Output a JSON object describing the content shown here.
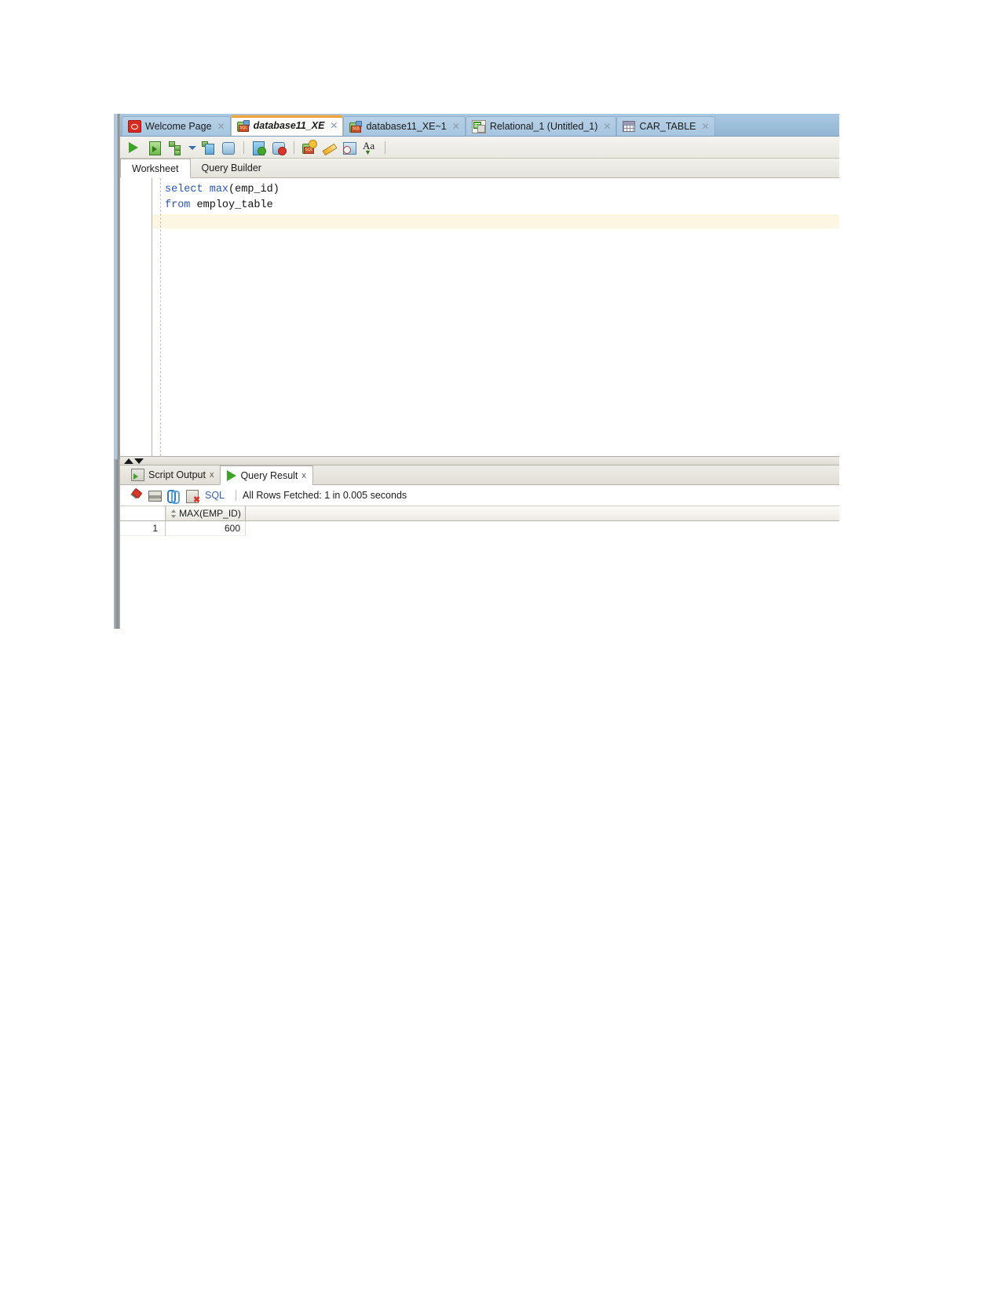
{
  "window": {
    "tabs": [
      {
        "label": "Welcome Page",
        "icon": "oracle-logo-icon",
        "active": false,
        "closable": true
      },
      {
        "label": "database11_XE",
        "icon": "database-connection-icon",
        "active": true,
        "closable": true
      },
      {
        "label": "database11_XE~1",
        "icon": "database-connection-icon",
        "active": false,
        "closable": true
      },
      {
        "label": "Relational_1 (Untitled_1)",
        "icon": "relational-model-icon",
        "active": false,
        "closable": true
      },
      {
        "label": "CAR_TABLE",
        "icon": "table-grid-icon",
        "active": false,
        "closable": true
      }
    ]
  },
  "toolbar": {
    "buttons": [
      {
        "name": "run-statement-button",
        "icon": "green-play-icon",
        "tooltip": "Run Statement"
      },
      {
        "name": "run-script-button",
        "icon": "run-script-icon",
        "tooltip": "Run Script"
      },
      {
        "name": "explain-plan-button",
        "icon": "explain-plan-icon",
        "tooltip": "Explain Plan"
      },
      {
        "name": "explain-plan-dropdown",
        "icon": "chevron-down-icon",
        "tooltip": "More"
      },
      {
        "name": "autotrace-button",
        "icon": "autotrace-icon",
        "tooltip": "Autotrace"
      },
      {
        "name": "sql-tuning-advisor-button",
        "icon": "sql-tuning-icon",
        "tooltip": "SQL Tuning Advisor"
      },
      {
        "name": "commit-button",
        "icon": "commit-icon",
        "tooltip": "Commit"
      },
      {
        "name": "rollback-button",
        "icon": "rollback-icon",
        "tooltip": "Rollback"
      },
      {
        "name": "unshared-sql-worksheet-button",
        "icon": "new-worksheet-icon",
        "tooltip": "Unshared SQL Worksheet"
      },
      {
        "name": "clear-button",
        "icon": "eraser-icon",
        "tooltip": "Clear"
      },
      {
        "name": "sql-history-button",
        "icon": "sql-history-icon",
        "tooltip": "SQL History"
      },
      {
        "name": "format-button",
        "icon": "font-size-icon",
        "tooltip": "Aa"
      }
    ]
  },
  "worksheet_tabs": [
    {
      "label": "Worksheet",
      "active": true
    },
    {
      "label": "Query Builder",
      "active": false
    }
  ],
  "editor": {
    "lines": [
      [
        {
          "t": "select ",
          "k": true
        },
        {
          "t": "max",
          "k": true
        },
        {
          "t": "(emp_id)",
          "k": false
        }
      ],
      [
        {
          "t": "from ",
          "k": true
        },
        {
          "t": "employ_table",
          "k": false
        }
      ]
    ],
    "line1_keyword": "select",
    "line1_func": "max",
    "line1_rest": "(emp_id)",
    "line2_keyword": "from",
    "line2_rest": "employ_table",
    "current_line": 3
  },
  "splitter": {
    "up_label": "collapse-up",
    "down_label": "collapse-down"
  },
  "output_tabs": [
    {
      "label": "Script Output",
      "icon": "script-output-icon",
      "active": false,
      "close": "x"
    },
    {
      "label": "Query Result",
      "icon": "green-play-icon",
      "active": true,
      "close": "x"
    }
  ],
  "result_toolbar": {
    "buttons": [
      {
        "name": "pin-results-button",
        "icon": "pin-icon"
      },
      {
        "name": "print-results-button",
        "icon": "printer-icon"
      },
      {
        "name": "refresh-results-button",
        "icon": "refresh-icon"
      },
      {
        "name": "clear-results-button",
        "icon": "clear-results-icon"
      }
    ],
    "sql_label": "SQL",
    "status": "All Rows Fetched: 1 in 0.005 seconds"
  },
  "result_grid": {
    "columns": [
      "MAX(EMP_ID)"
    ],
    "rows": [
      {
        "num": "1",
        "values": [
          "600"
        ]
      }
    ]
  },
  "colors": {
    "tabbar_blue": "#9ebfdb",
    "active_tab_orange": "#e8952a",
    "keyword_blue": "#2b57b5",
    "current_line_highlight": "#fdf6e3",
    "sql_link": "#3a5fa8",
    "run_green": "#3fa32b"
  }
}
